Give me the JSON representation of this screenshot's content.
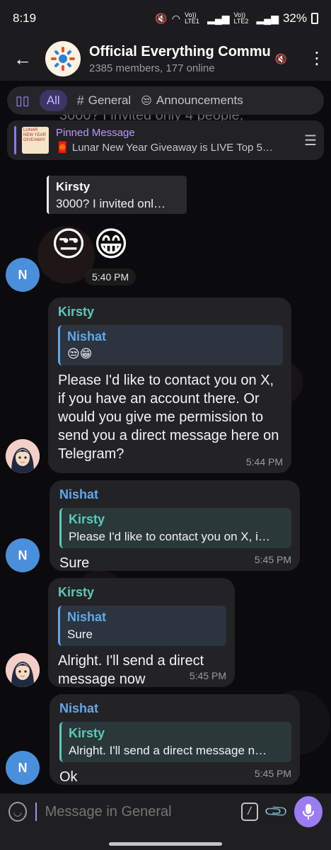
{
  "status_bar": {
    "time": "8:19",
    "sim1": "Vo)) LTE1",
    "sim2": "Vo)) LTE2",
    "battery": "32%",
    "icons": [
      "mute-icon",
      "wifi-icon",
      "signal-icon",
      "signal-icon",
      "battery-icon"
    ]
  },
  "header": {
    "back_icon": "arrow-left-icon",
    "title": "Official Everything Commu",
    "subtitle": "2385 members, 177 online",
    "mute_icon": "muted-speaker-icon",
    "more_icon": "vertical-dots-icon"
  },
  "topics": {
    "sidebar_icon": "sidebar-icon",
    "tabs": [
      {
        "label": "All",
        "active": true
      },
      {
        "label": "General",
        "icon": "#"
      },
      {
        "label": "Announcements",
        "icon": "emoji"
      }
    ],
    "partial_background_text": "3000? I invited only 4 people,"
  },
  "pinned": {
    "title": "Pinned Message",
    "body": "Lunar New Year Giveaway is LIVE  Top 5…",
    "thumb_text": "LUNAR NEW YEAR GIVEAWAY",
    "list_icon": "pin-list-icon"
  },
  "messages": {
    "m1": {
      "sender": "Kirsty",
      "text": "3000? I invited onl…"
    },
    "m2": {
      "avatar_letter": "N",
      "emojis": "😒😁",
      "time": "5:40 PM"
    },
    "m3": {
      "sender": "Kirsty",
      "reply_name": "Nishat",
      "reply_text": "😒😁",
      "text": "Please I'd like to contact you on X, if you have an account there. Or would you give me permission to send you a direct message here on Telegram?",
      "time": "5:44 PM"
    },
    "m4": {
      "avatar_letter": "N",
      "sender": "Nishat",
      "reply_name": "Kirsty",
      "reply_text": "Please I'd like to contact you on X, i…",
      "text": "Sure",
      "time": "5:45 PM"
    },
    "m5": {
      "sender": "Kirsty",
      "reply_name": "Nishat",
      "reply_text": "Sure",
      "text": "Alright. I'll send a direct message now",
      "time": "5:45 PM"
    },
    "m6": {
      "avatar_letter": "N",
      "sender": "Nishat",
      "reply_name": "Kirsty",
      "reply_text": "Alright. I'll send a direct message n…",
      "text": "Ok",
      "time": "5:45 PM"
    }
  },
  "input": {
    "placeholder": "Message in General",
    "icons": [
      "smile-icon",
      "command-icon",
      "attach-icon",
      "mic-icon"
    ]
  },
  "colors": {
    "accent": "#9c7cf2",
    "kirsty": "#5ec9b8",
    "nishat": "#62a8ea",
    "bubble": "#232326"
  }
}
